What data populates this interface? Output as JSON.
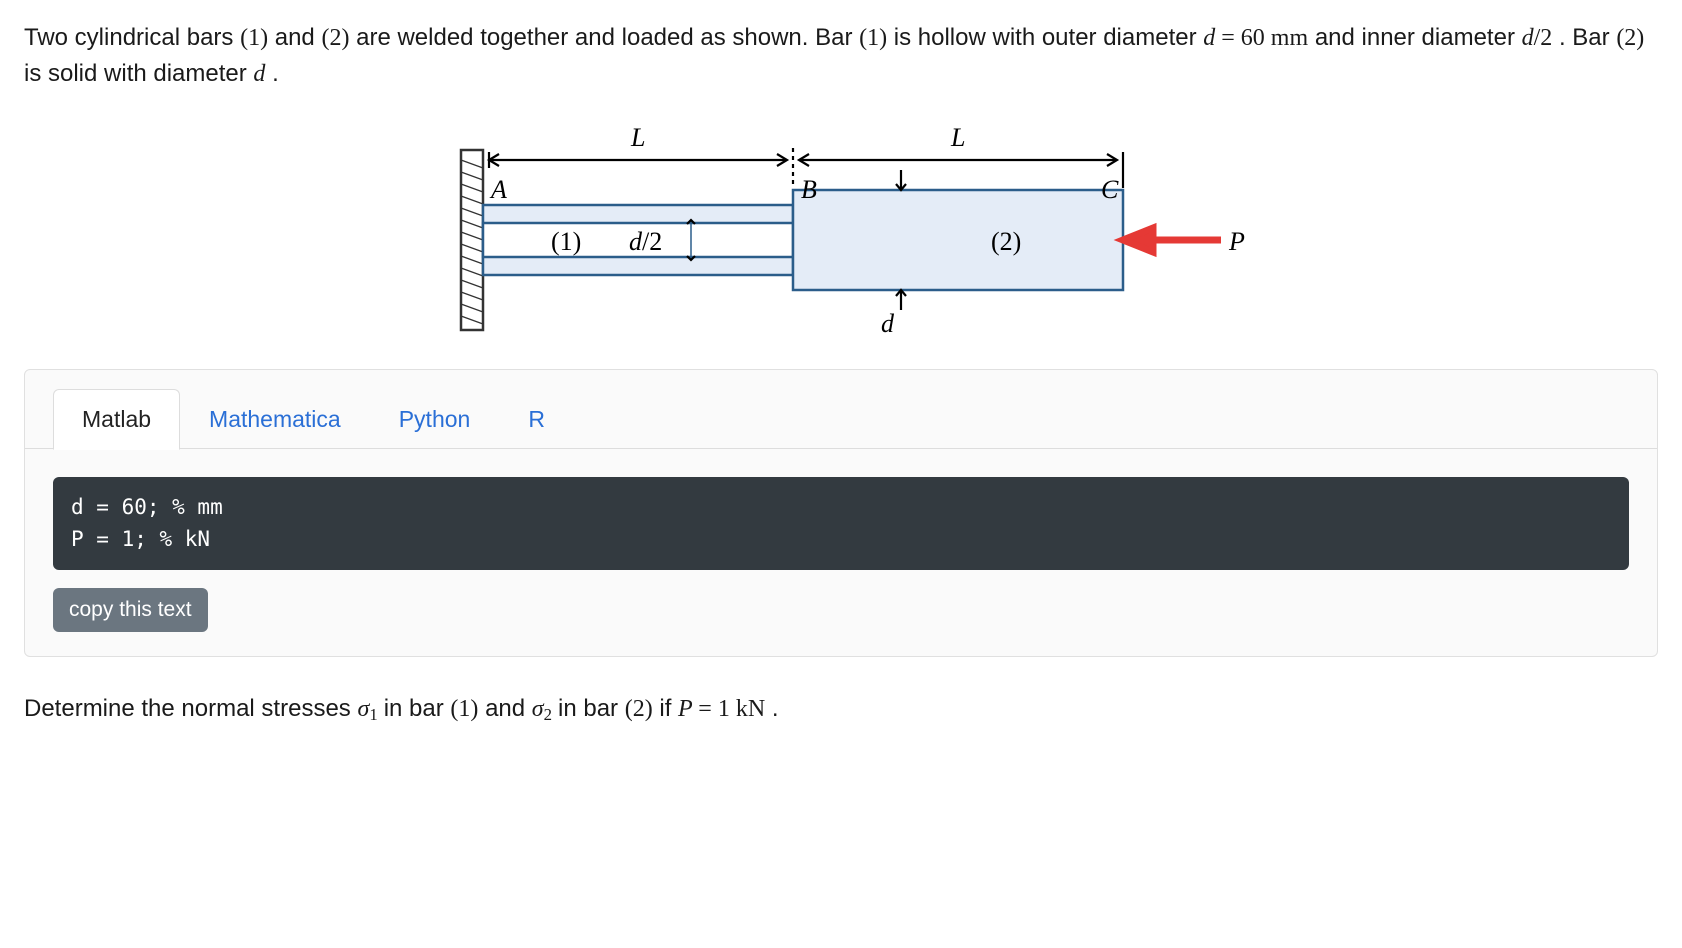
{
  "problem": {
    "sentence1_a": "Two cylindrical bars ",
    "paren1": "(1)",
    "sentence1_b": " and ",
    "paren2": "(2)",
    "sentence1_c": " are welded together and loaded as shown. Bar ",
    "paren1b": "(1)",
    "sentence1_d": " is hollow with outer diameter ",
    "d_eq": "d = 60 mm",
    "sentence1_e": " and inner diameter ",
    "d_half": "d/2",
    "sentence1_f": ". Bar ",
    "paren2b": "(2)",
    "sentence1_g": " is solid with diameter ",
    "d_var": "d",
    "period": "."
  },
  "diagram": {
    "L1": "L",
    "L2": "L",
    "A": "A",
    "B": "B",
    "C": "C",
    "bar1": "(1)",
    "bar2": "(2)",
    "d_half": "d/2",
    "d": "d",
    "P": "P"
  },
  "tabs": {
    "t0": "Matlab",
    "t1": "Mathematica",
    "t2": "Python",
    "t3": "R"
  },
  "code": "d = 60; % mm\nP = 1; % kN",
  "copy_label": "copy this text",
  "question": {
    "a": "Determine the normal stresses ",
    "sigma1_var": "σ",
    "sigma1_sub": "1",
    "b": " in bar ",
    "paren1": "(1)",
    "c": " and ",
    "sigma2_var": "σ",
    "sigma2_sub": "2",
    "d": " in bar ",
    "paren2": "(2)",
    "e": " if ",
    "P_eq": "P = 1 kN",
    "f": "."
  }
}
